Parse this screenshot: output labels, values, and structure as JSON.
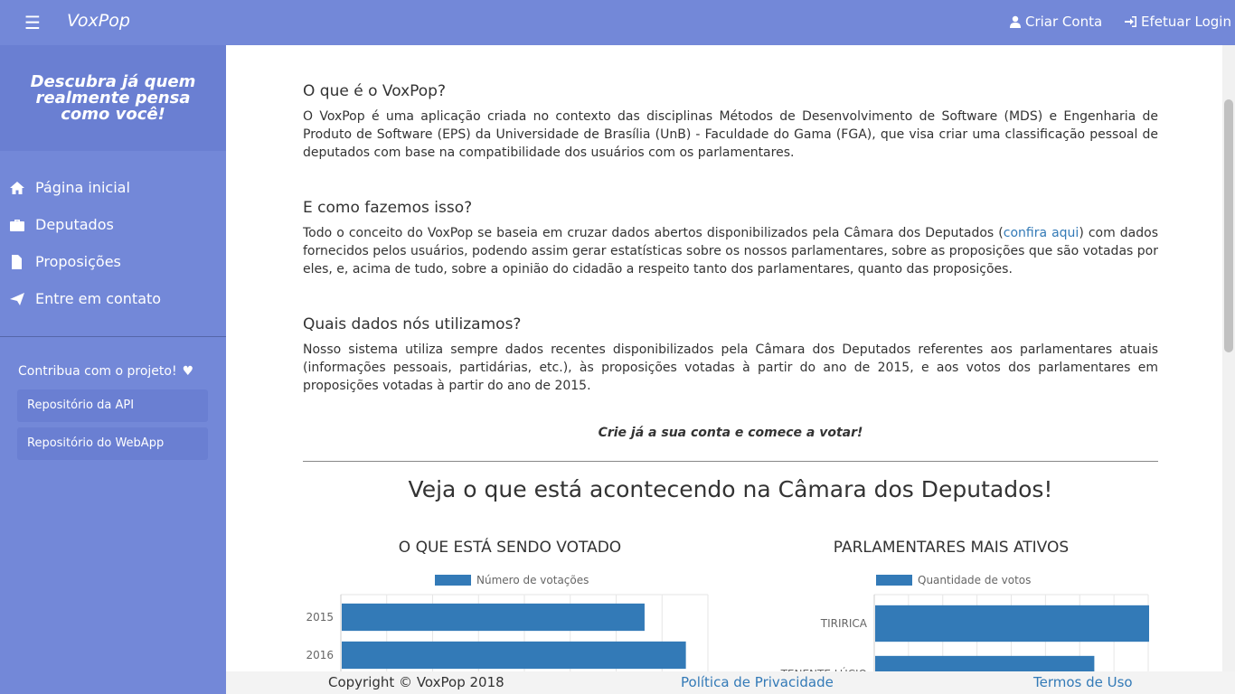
{
  "navbar": {
    "menu_icon": "hamburger-icon",
    "brand": "VoxPop",
    "create_account": "Criar Conta",
    "login": "Efetuar Login"
  },
  "sidebar": {
    "slogan": "Descubra já quem realmente pensa como você!",
    "items": [
      {
        "label": "Página inicial",
        "icon": "home-icon"
      },
      {
        "label": "Deputados",
        "icon": "briefcase-icon"
      },
      {
        "label": "Proposições",
        "icon": "file-icon"
      },
      {
        "label": "Entre em contato",
        "icon": "send-icon"
      }
    ],
    "contribute": "Contribua com o projeto!",
    "repos": [
      "Repositório da API",
      "Repositório do WebApp"
    ]
  },
  "main": {
    "sections": [
      {
        "title": "O que é o VoxPop?",
        "text": "O VoxPop é uma aplicação criada no contexto das disciplinas Métodos de Desenvolvimento de Software (MDS) e Engenharia de Produto de Software (EPS) da Universidade de Brasília (UnB) - Faculdade do Gama (FGA), que visa criar uma classificação pessoal de deputados com base na compatibilidade dos usuários com os parlamentares."
      },
      {
        "title": "E como fazemos isso?",
        "text_before": "Todo o conceito do VoxPop se baseia em cruzar dados abertos disponibilizados pela Câmara dos Deputados (",
        "link": "confira aqui",
        "text_after": ") com dados fornecidos pelos usuários, podendo assim gerar estatísticas sobre os nossos parlamentares, sobre as proposições que são votadas por eles, e, acima de tudo, sobre a opinião do cidadão a respeito tanto dos parlamentares, quanto das proposições."
      },
      {
        "title": "Quais dados nós utilizamos?",
        "text": "Nosso sistema utiliza sempre dados recentes disponibilizados pela Câmara dos Deputados referentes aos parlamentares atuais (informações pessoais, partidárias, etc.), às proposições votadas à partir do ano de 2015, e aos votos dos parlamentares em proposições votadas à partir do ano de 2015."
      }
    ],
    "cta": "Crie já a sua conta e comece a votar!",
    "camara_title": "Veja o que está acontecendo na Câmara dos Deputados!"
  },
  "chart_data": [
    {
      "type": "bar",
      "title": "O QUE ESTÁ SENDO VOTADO",
      "legend": "Número de votações",
      "orientation": "horizontal",
      "categories": [
        "2015",
        "2016"
      ],
      "values": [
        66,
        75
      ],
      "xlim": [
        0,
        80
      ],
      "grid": true,
      "legend_position": "top"
    },
    {
      "type": "bar",
      "title": "PARLAMENTARES MAIS ATIVOS",
      "legend": "Quantidade de votos",
      "orientation": "horizontal",
      "categories": [
        "TIRIRICA",
        "TENENTE LÚCIO"
      ],
      "values": [
        100,
        80
      ],
      "xlim": [
        0,
        100
      ],
      "grid": true,
      "legend_position": "top"
    }
  ],
  "footer": {
    "copyright": "Copyright © VoxPop 2018",
    "privacy": "Política de Privacidade",
    "terms": "Termos de Uso"
  },
  "colors": {
    "primary": "#7388d8",
    "bar": "#337ab7",
    "link": "#337ab7"
  }
}
